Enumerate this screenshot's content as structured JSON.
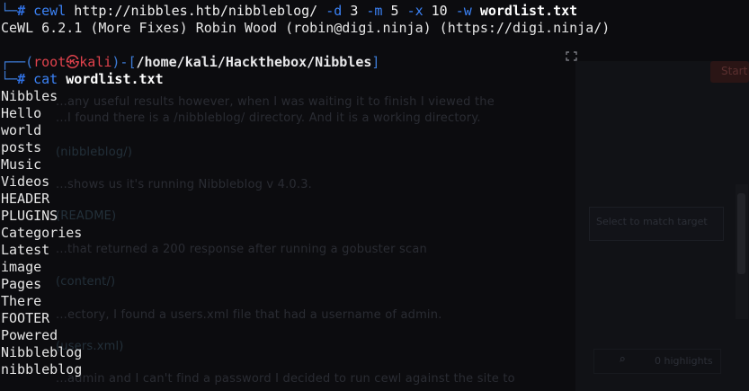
{
  "colors": {
    "background": "#0c0c0f",
    "prompt_user": "#e0424c",
    "prompt_frame": "#3d7bd6",
    "command": "#3b82f6",
    "text": "#e6e6e6"
  },
  "terminal": {
    "prev_prompt": {
      "frame": "└─",
      "hash": "#",
      "command": "cewl",
      "url": "http://nibbles.htb/nibbleblog/",
      "flag_d": "-d",
      "val_d": "3",
      "flag_m": "-m",
      "val_m": "5",
      "flag_x": "-x",
      "val_x": "10",
      "flag_w": "-w",
      "file": "wordlist.txt"
    },
    "cewl_banner": "CeWL 6.2.1 (More Fixes) Robin Wood (robin@digi.ninja) (https://digi.ninja/)",
    "prompt": {
      "frame_top": "┌──(",
      "user": "root",
      "at": "㉿",
      "host": "kali",
      "close_paren": ")-[",
      "path": "/home/kali/Hackthebox/Nibbles",
      "close_bracket": "]",
      "frame_bottom": "└─",
      "hash": "#",
      "command": "cat",
      "arg": "wordlist.txt"
    },
    "wordlist": [
      "Nibbles",
      "Hello",
      "world",
      "posts",
      "Music",
      "Videos",
      "HEADER",
      "PLUGINS",
      "Categories",
      "Latest",
      "image",
      "Pages",
      "There",
      "FOOTER",
      "Powered",
      "Nibbleblog",
      "nibbleblog"
    ]
  },
  "background": {
    "para1": "...any useful results however, when I was waiting it to finish I viewed the",
    "para2": "...I found there is a /nibbleblog/ directory. And it is a working directory.",
    "link1": "(nibbleblog/)",
    "para3": "...shows us it's running Nibbleblog v 4.0.3.",
    "link2": "(README)",
    "para4": "...that returned a 200 response after running a gobuster scan",
    "link3": "(content/)",
    "para5": "...ectory, I found a users.xml file that had a username of admin.",
    "link4": "(users.xml)",
    "para6": "...admin and I can't find a password I decided to run cewl against the site to",
    "panel_label": "Select to match target",
    "tab_label": "Start",
    "highlights": "0 highlights"
  }
}
